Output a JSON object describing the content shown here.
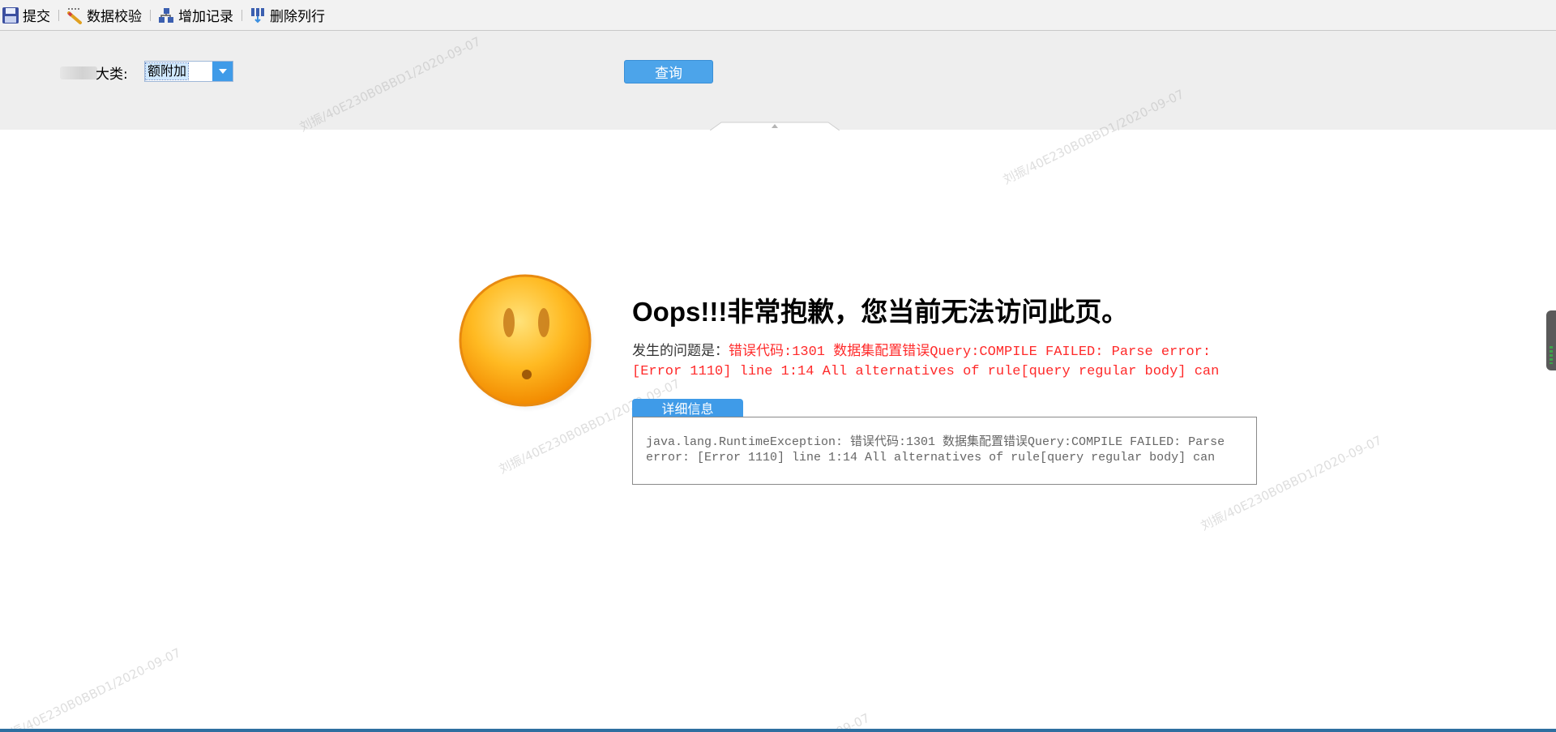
{
  "toolbar": {
    "items": [
      {
        "label": "提交",
        "icon": "save-icon"
      },
      {
        "label": "数据校验",
        "icon": "pencil-icon"
      },
      {
        "label": "增加记录",
        "icon": "add-record-icon"
      },
      {
        "label": "删除列行",
        "icon": "delete-row-icon"
      }
    ]
  },
  "filter": {
    "category_label": "大类:",
    "category_value": "额附加",
    "query_button": "查询"
  },
  "error": {
    "title": "Oops!!!非常抱歉，您当前无法访问此页。",
    "problem_label": "发生的问题是：",
    "problem_message": "错误代码:1301 数据集配置错误Query:COMPILE FAILED: Parse error: [Error 1110] line 1:14 All alternatives of rule[query regular body] can",
    "detail_button": "详细信息",
    "detail_text": "java.lang.RuntimeException: 错误代码:1301 数据集配置错误Query:COMPILE FAILED: Parse error: [Error 1110] line 1:14 All alternatives of rule[query regular body] can"
  },
  "watermark": {
    "text": "刘振/40E230B0BBD1/2020-09-07",
    "bottom_text": "-09-07"
  },
  "colors": {
    "accent_blue": "#4ca4ea",
    "error_red": "#ff2a2a",
    "toolbar_bg": "#f2f2f2",
    "panel_bg": "#eeeeee"
  }
}
